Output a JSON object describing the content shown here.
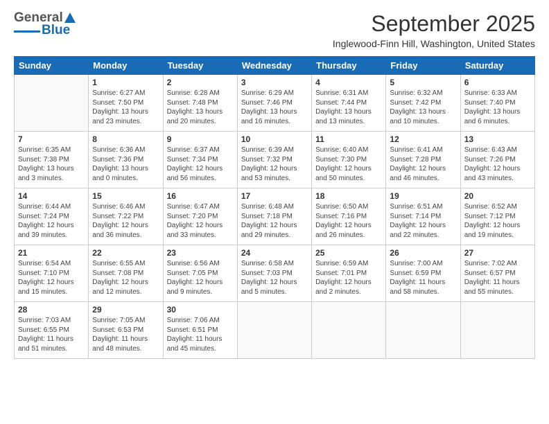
{
  "header": {
    "logo": {
      "name_general": "General",
      "name_blue": "Blue"
    },
    "title": "September 2025",
    "location": "Inglewood-Finn Hill, Washington, United States"
  },
  "calendar": {
    "days_of_week": [
      "Sunday",
      "Monday",
      "Tuesday",
      "Wednesday",
      "Thursday",
      "Friday",
      "Saturday"
    ],
    "weeks": [
      [
        {
          "day": "",
          "info": ""
        },
        {
          "day": "1",
          "info": "Sunrise: 6:27 AM\nSunset: 7:50 PM\nDaylight: 13 hours\nand 23 minutes."
        },
        {
          "day": "2",
          "info": "Sunrise: 6:28 AM\nSunset: 7:48 PM\nDaylight: 13 hours\nand 20 minutes."
        },
        {
          "day": "3",
          "info": "Sunrise: 6:29 AM\nSunset: 7:46 PM\nDaylight: 13 hours\nand 16 minutes."
        },
        {
          "day": "4",
          "info": "Sunrise: 6:31 AM\nSunset: 7:44 PM\nDaylight: 13 hours\nand 13 minutes."
        },
        {
          "day": "5",
          "info": "Sunrise: 6:32 AM\nSunset: 7:42 PM\nDaylight: 13 hours\nand 10 minutes."
        },
        {
          "day": "6",
          "info": "Sunrise: 6:33 AM\nSunset: 7:40 PM\nDaylight: 13 hours\nand 6 minutes."
        }
      ],
      [
        {
          "day": "7",
          "info": "Sunrise: 6:35 AM\nSunset: 7:38 PM\nDaylight: 13 hours\nand 3 minutes."
        },
        {
          "day": "8",
          "info": "Sunrise: 6:36 AM\nSunset: 7:36 PM\nDaylight: 13 hours\nand 0 minutes."
        },
        {
          "day": "9",
          "info": "Sunrise: 6:37 AM\nSunset: 7:34 PM\nDaylight: 12 hours\nand 56 minutes."
        },
        {
          "day": "10",
          "info": "Sunrise: 6:39 AM\nSunset: 7:32 PM\nDaylight: 12 hours\nand 53 minutes."
        },
        {
          "day": "11",
          "info": "Sunrise: 6:40 AM\nSunset: 7:30 PM\nDaylight: 12 hours\nand 50 minutes."
        },
        {
          "day": "12",
          "info": "Sunrise: 6:41 AM\nSunset: 7:28 PM\nDaylight: 12 hours\nand 46 minutes."
        },
        {
          "day": "13",
          "info": "Sunrise: 6:43 AM\nSunset: 7:26 PM\nDaylight: 12 hours\nand 43 minutes."
        }
      ],
      [
        {
          "day": "14",
          "info": "Sunrise: 6:44 AM\nSunset: 7:24 PM\nDaylight: 12 hours\nand 39 minutes."
        },
        {
          "day": "15",
          "info": "Sunrise: 6:46 AM\nSunset: 7:22 PM\nDaylight: 12 hours\nand 36 minutes."
        },
        {
          "day": "16",
          "info": "Sunrise: 6:47 AM\nSunset: 7:20 PM\nDaylight: 12 hours\nand 33 minutes."
        },
        {
          "day": "17",
          "info": "Sunrise: 6:48 AM\nSunset: 7:18 PM\nDaylight: 12 hours\nand 29 minutes."
        },
        {
          "day": "18",
          "info": "Sunrise: 6:50 AM\nSunset: 7:16 PM\nDaylight: 12 hours\nand 26 minutes."
        },
        {
          "day": "19",
          "info": "Sunrise: 6:51 AM\nSunset: 7:14 PM\nDaylight: 12 hours\nand 22 minutes."
        },
        {
          "day": "20",
          "info": "Sunrise: 6:52 AM\nSunset: 7:12 PM\nDaylight: 12 hours\nand 19 minutes."
        }
      ],
      [
        {
          "day": "21",
          "info": "Sunrise: 6:54 AM\nSunset: 7:10 PM\nDaylight: 12 hours\nand 15 minutes."
        },
        {
          "day": "22",
          "info": "Sunrise: 6:55 AM\nSunset: 7:08 PM\nDaylight: 12 hours\nand 12 minutes."
        },
        {
          "day": "23",
          "info": "Sunrise: 6:56 AM\nSunset: 7:05 PM\nDaylight: 12 hours\nand 9 minutes."
        },
        {
          "day": "24",
          "info": "Sunrise: 6:58 AM\nSunset: 7:03 PM\nDaylight: 12 hours\nand 5 minutes."
        },
        {
          "day": "25",
          "info": "Sunrise: 6:59 AM\nSunset: 7:01 PM\nDaylight: 12 hours\nand 2 minutes."
        },
        {
          "day": "26",
          "info": "Sunrise: 7:00 AM\nSunset: 6:59 PM\nDaylight: 11 hours\nand 58 minutes."
        },
        {
          "day": "27",
          "info": "Sunrise: 7:02 AM\nSunset: 6:57 PM\nDaylight: 11 hours\nand 55 minutes."
        }
      ],
      [
        {
          "day": "28",
          "info": "Sunrise: 7:03 AM\nSunset: 6:55 PM\nDaylight: 11 hours\nand 51 minutes."
        },
        {
          "day": "29",
          "info": "Sunrise: 7:05 AM\nSunset: 6:53 PM\nDaylight: 11 hours\nand 48 minutes."
        },
        {
          "day": "30",
          "info": "Sunrise: 7:06 AM\nSunset: 6:51 PM\nDaylight: 11 hours\nand 45 minutes."
        },
        {
          "day": "",
          "info": ""
        },
        {
          "day": "",
          "info": ""
        },
        {
          "day": "",
          "info": ""
        },
        {
          "day": "",
          "info": ""
        }
      ]
    ]
  }
}
